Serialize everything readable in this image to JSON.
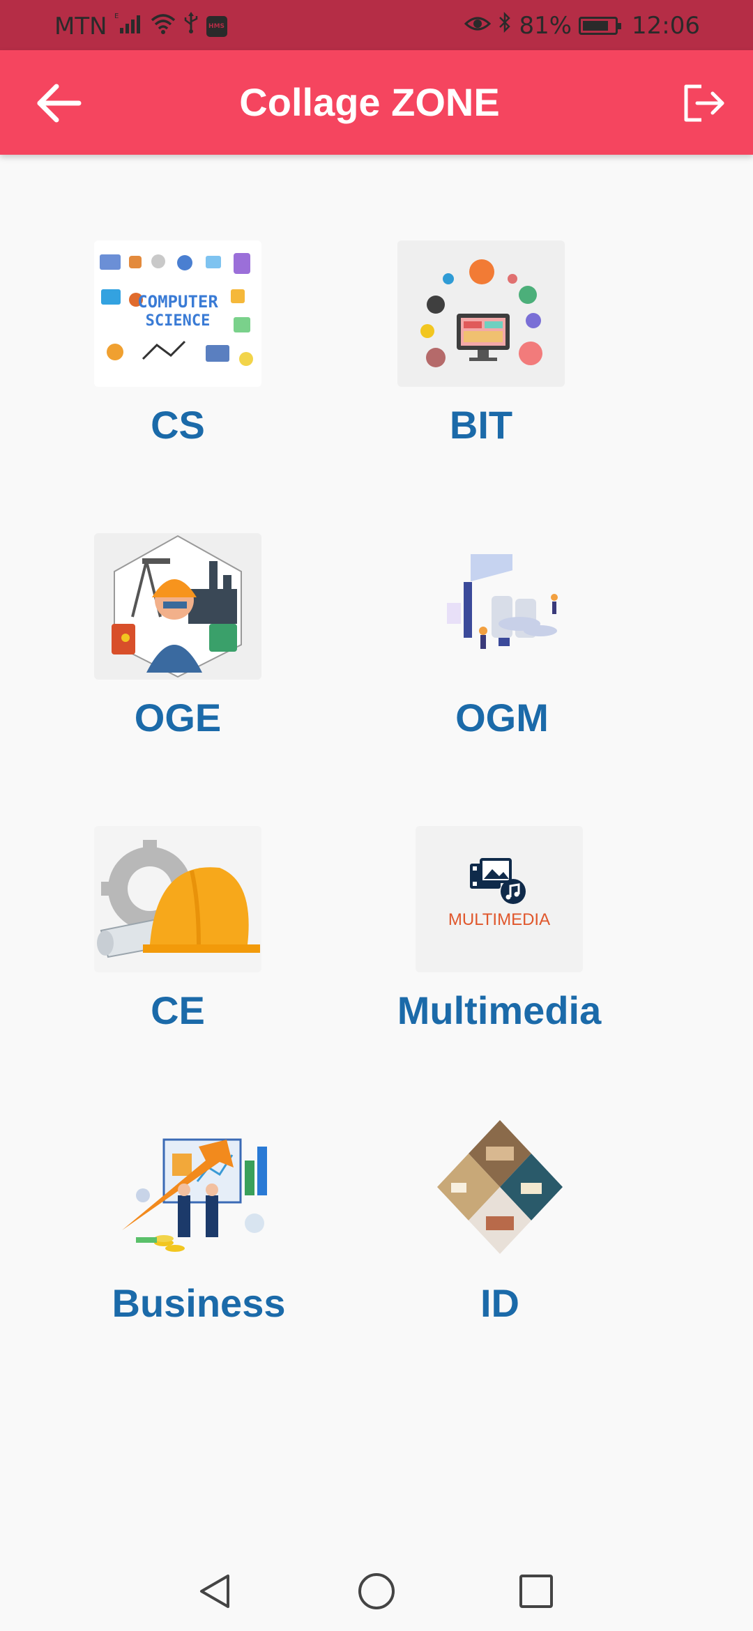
{
  "status_bar": {
    "carrier": "MTN",
    "network_type": "E",
    "battery_percent": "81%",
    "battery_level": 0.81,
    "time": "12:06",
    "hms_badge": "HMS"
  },
  "app_bar": {
    "title": "Collage ZONE",
    "back_icon": "arrow-left-icon",
    "logout_icon": "logout-icon"
  },
  "tiles": [
    {
      "label": "CS",
      "image_text_line1": "COMPUTER",
      "image_text_line2": "SCIENCE"
    },
    {
      "label": "BIT"
    },
    {
      "label": "OGE"
    },
    {
      "label": "OGM"
    },
    {
      "label": "CE"
    },
    {
      "label": "Multimedia",
      "image_text": "MULTIMEDIA"
    },
    {
      "label": "Business"
    },
    {
      "label": "ID"
    }
  ],
  "nav_bar": {
    "back": "nav-back-icon",
    "home": "nav-home-icon",
    "recents": "nav-recents-icon"
  },
  "colors": {
    "status_bar": "#b52d46",
    "app_bar": "#f5455f",
    "label": "#1b6aa9",
    "background": "#f9f9f9"
  }
}
